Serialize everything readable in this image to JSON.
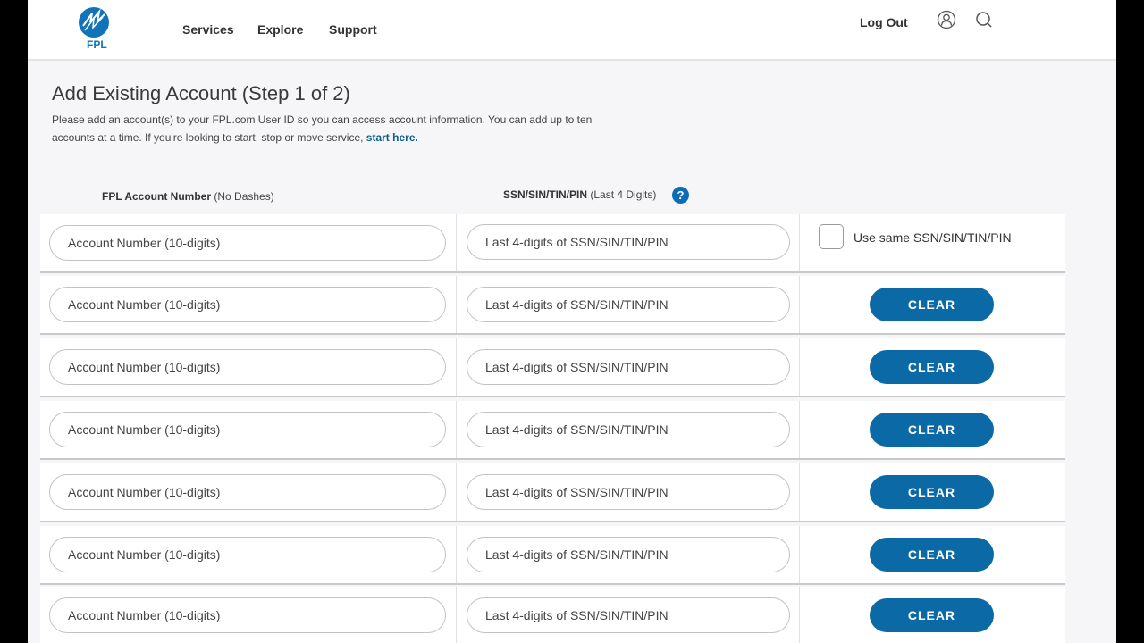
{
  "header": {
    "logo_text": "FPL",
    "nav": [
      "Services",
      "Explore",
      "Support"
    ],
    "logout_label": "Log Out",
    "icons": {
      "account": "user-circle-icon",
      "search": "search-icon"
    }
  },
  "page": {
    "title": "Add Existing Account (Step 1 of 2)",
    "intro_text": "Please add an account(s) to your FPL.com User ID so you can access account information. You can add up to ten accounts at a time. If you're looking to start, stop or move service,",
    "intro_link": "start here."
  },
  "columns": {
    "account_label_bold": "FPL Account Number",
    "account_label_note": "(No Dashes)",
    "ssn_label_bold": "SSN/SIN/TIN/PIN",
    "ssn_label_note": "(Last 4 Digits)",
    "help_glyph": "?"
  },
  "form": {
    "account_placeholder": "Account Number (10-digits)",
    "ssn_placeholder": "Last 4-digits of SSN/SIN/TIN/PIN",
    "same_ssn_label": "Use same SSN/SIN/TIN/PIN",
    "same_ssn_checked": false,
    "clear_label": "CLEAR",
    "rows": [
      {
        "account": "",
        "ssn": ""
      },
      {
        "account": "",
        "ssn": ""
      },
      {
        "account": "",
        "ssn": ""
      },
      {
        "account": "",
        "ssn": ""
      },
      {
        "account": "",
        "ssn": ""
      },
      {
        "account": "",
        "ssn": ""
      },
      {
        "account": "",
        "ssn": ""
      }
    ]
  },
  "colors": {
    "brand_blue": "#0b6aa6",
    "link_blue": "#0a5c91"
  }
}
